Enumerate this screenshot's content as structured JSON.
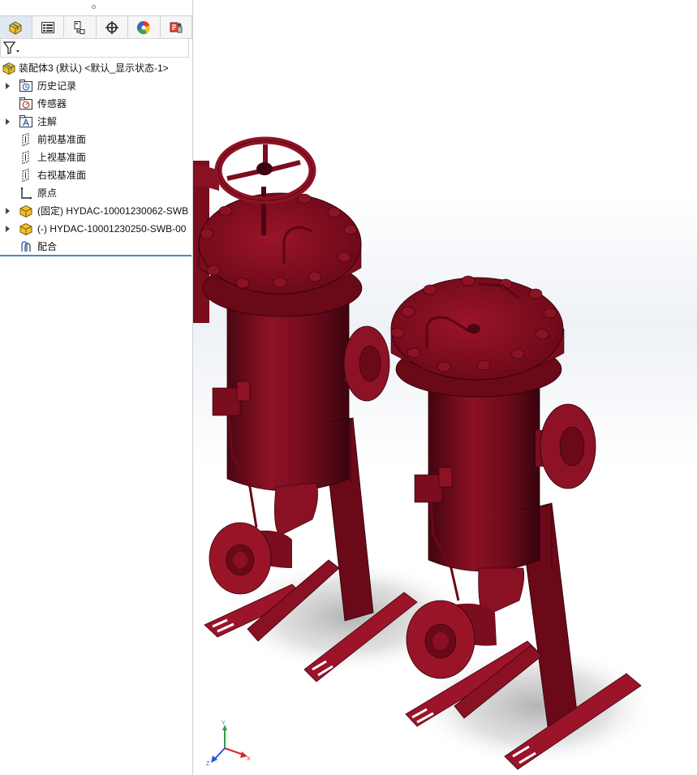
{
  "panel": {
    "tabs": [
      {
        "name": "tab-feature-manager",
        "icon": "assembly-icon",
        "active": true
      },
      {
        "name": "tab-property-manager",
        "icon": "property-list-icon",
        "active": false
      },
      {
        "name": "tab-configuration-manager",
        "icon": "configuration-icon",
        "active": false
      },
      {
        "name": "tab-dimxpert-manager",
        "icon": "crosshair-icon",
        "active": false
      },
      {
        "name": "tab-display-manager",
        "icon": "color-wheel-icon",
        "active": false
      },
      {
        "name": "tab-cam-manager",
        "icon": "cam-icon",
        "active": false
      }
    ],
    "filter_icon": "filter-icon"
  },
  "tree": {
    "root": "装配体3 (默认) <默认_显示状态-1>",
    "items": [
      {
        "label": "历史记录",
        "icon": "history-folder-icon",
        "expandable": true
      },
      {
        "label": "传感器",
        "icon": "sensor-folder-icon",
        "expandable": false
      },
      {
        "label": "注解",
        "icon": "annotation-folder-icon",
        "expandable": true
      },
      {
        "label": "前视基准面",
        "icon": "plane-icon",
        "expandable": false
      },
      {
        "label": "上视基准面",
        "icon": "plane-icon",
        "expandable": false
      },
      {
        "label": "右视基准面",
        "icon": "plane-icon",
        "expandable": false
      },
      {
        "label": "原点",
        "icon": "origin-icon",
        "expandable": false
      },
      {
        "label": "(固定) HYDAC-10001230062-SWB",
        "icon": "component-icon",
        "expandable": true
      },
      {
        "label": "(-) HYDAC-10001230250-SWB-00",
        "icon": "component-icon",
        "expandable": true
      },
      {
        "label": "配合",
        "icon": "mates-icon",
        "expandable": false
      }
    ]
  },
  "viewport": {
    "model_color": "#8c0f22",
    "triad": {
      "x": "X",
      "y": "Y",
      "z": "Z"
    }
  }
}
